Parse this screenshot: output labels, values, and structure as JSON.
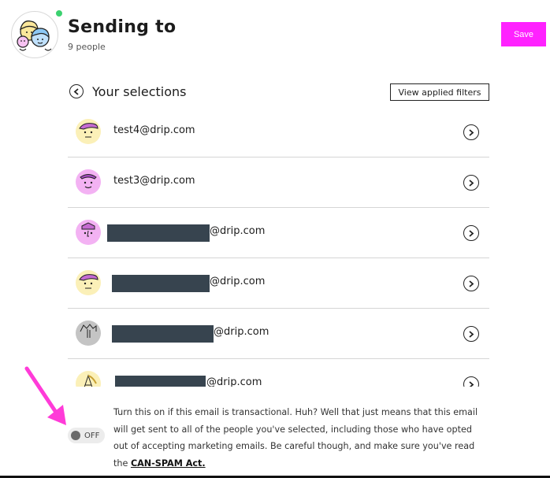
{
  "header": {
    "title": "Sending to",
    "subtitle": "9 people",
    "save_label": "Save",
    "accent": "#ff22ff",
    "online_color": "#3bd16f"
  },
  "selections": {
    "title": "Your selections",
    "filters_label": "View applied filters"
  },
  "recipients": [
    {
      "email": "test4@drip.com",
      "avatar_color": "#fbf0b8"
    },
    {
      "email": "test3@drip.com",
      "avatar_color": "#f3b2f3"
    },
    {
      "email": "@drip.com",
      "avatar_color": "#f3b2f3",
      "redacted": true
    },
    {
      "email": "@drip.com",
      "avatar_color": "#fbf0b8",
      "redacted": true
    },
    {
      "email": "@drip.com",
      "avatar_color": "#c4c4c4",
      "redacted": true
    },
    {
      "email": "@drip.com",
      "avatar_color": "#fbf0b8",
      "redacted": true
    }
  ],
  "transactional": {
    "toggle_label": "OFF",
    "note_text": "Turn this on if this email is transactional. Huh? Well that just means that this email will get sent to all of the people you've selected, including those who have opted out of accepting marketing emails. Be careful though, and make sure you've read the",
    "link_text": "CAN-SPAM Act."
  }
}
